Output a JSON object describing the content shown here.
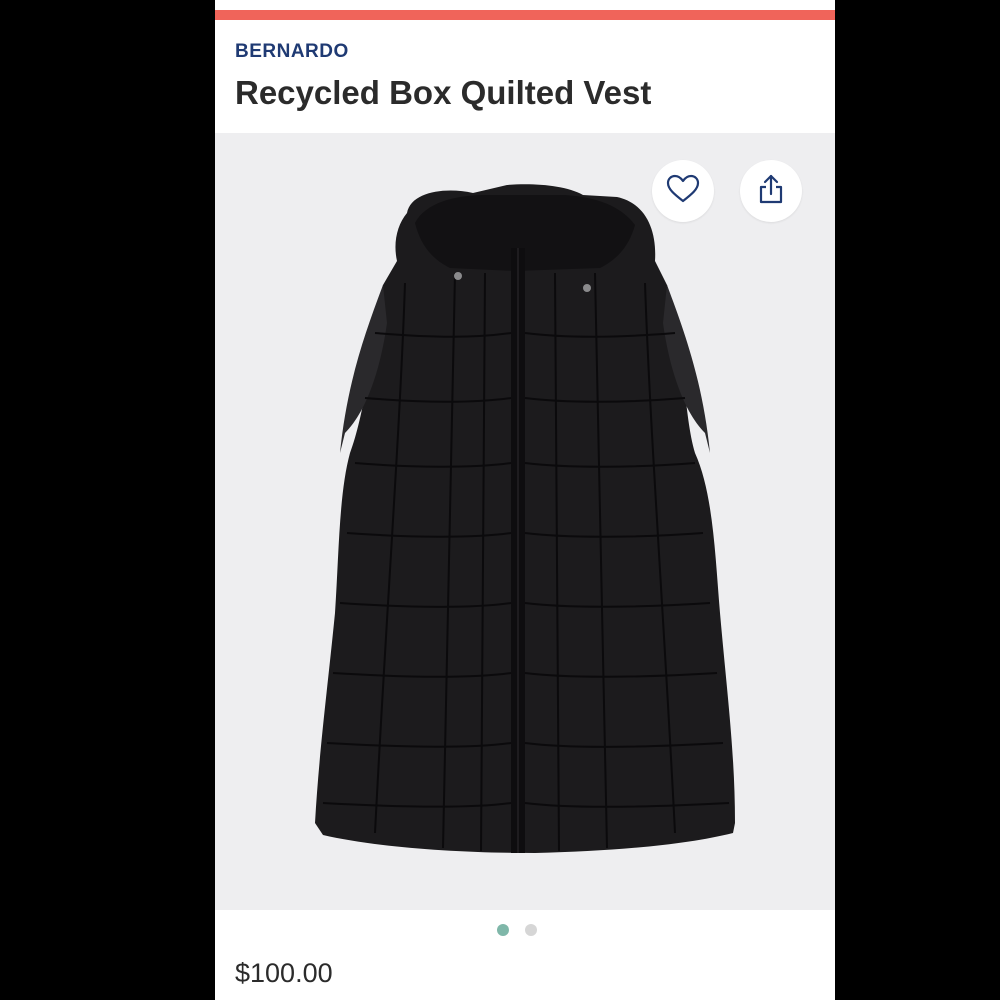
{
  "product": {
    "brand": "BERNARDO",
    "title": "Recycled Box Quilted Vest",
    "price": "$100.00"
  },
  "actions": {
    "favorite_icon": "heart-outline-icon",
    "share_icon": "share-icon"
  },
  "gallery": {
    "image_count": 2,
    "active_index": 0
  },
  "colors": {
    "accent": "#f0645a",
    "brand": "#1f3a73",
    "active_dot": "#7fb7a9",
    "image_background": "#eeeef0"
  }
}
